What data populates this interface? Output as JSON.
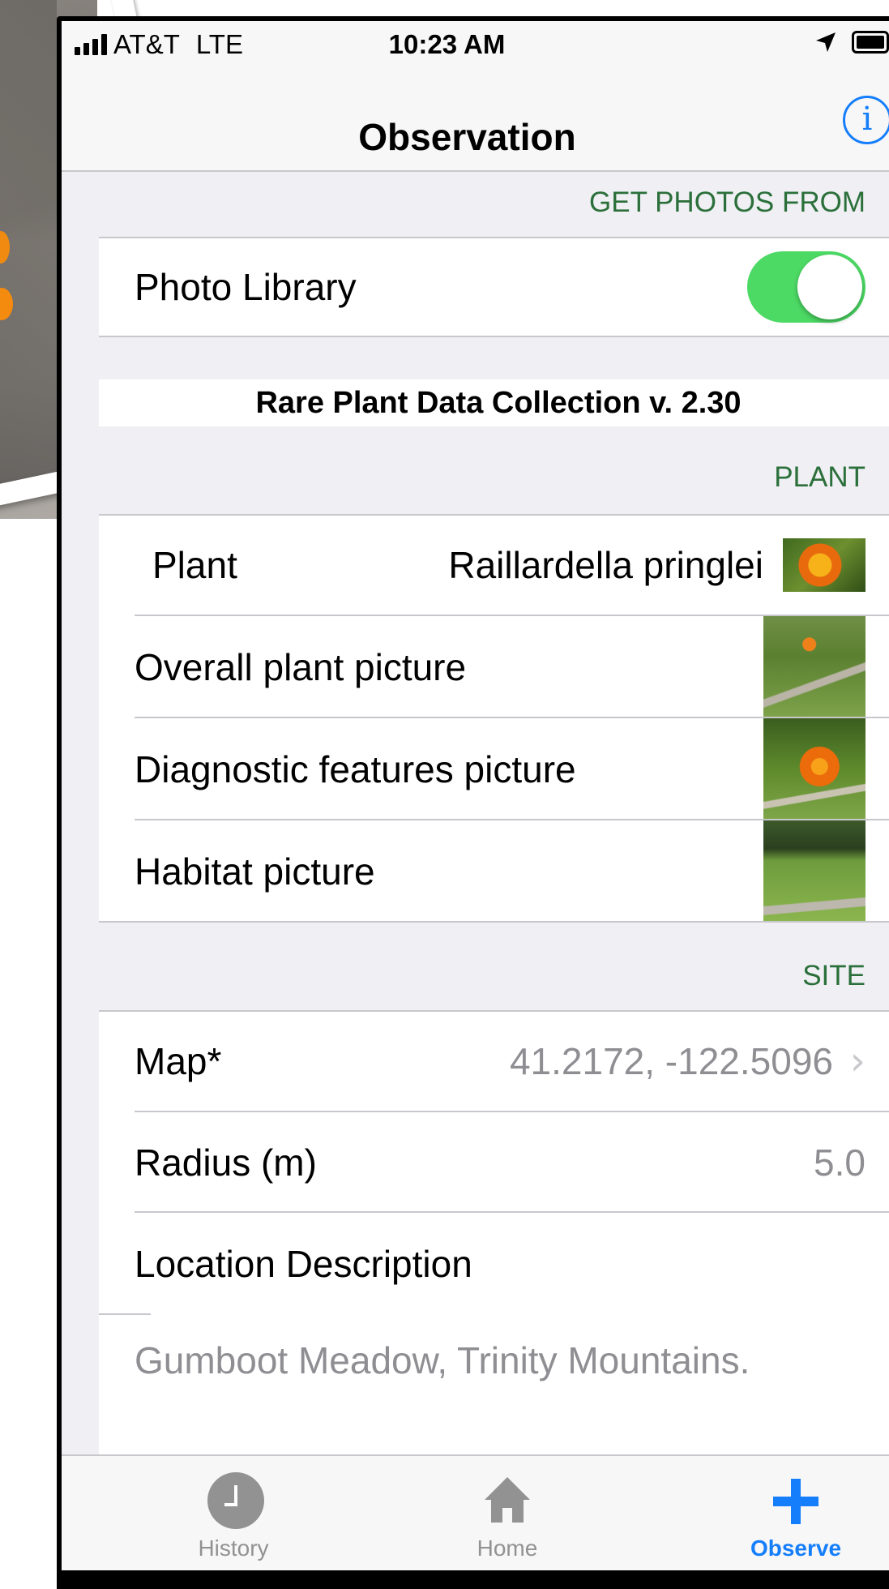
{
  "status_bar": {
    "carrier": "AT&T",
    "network": "LTE",
    "time": "10:23 AM"
  },
  "nav": {
    "title": "Observation",
    "info_icon": "info-icon"
  },
  "sections": {
    "photos_header": "GET PHOTOS FROM",
    "photo_library_label": "Photo Library",
    "photo_library_enabled": true,
    "footer_title": "Rare Plant Data Collection v. 2.30",
    "plant_header": "PLANT",
    "plant_label": "Plant",
    "plant_value": "Raillardella pringlei",
    "overall_label": "Overall plant picture",
    "diagnostic_label": "Diagnostic features picture",
    "habitat_label": "Habitat picture",
    "site_header": "SITE",
    "map_label": "Map*",
    "map_value": "41.2172, -122.5096",
    "radius_label": "Radius (m)",
    "radius_value": "5.0",
    "location_label": "Location Description",
    "location_value": "Gumboot Meadow, Trinity Mountains."
  },
  "tabs": [
    {
      "label": "History",
      "icon": "clock-icon",
      "active": false
    },
    {
      "label": "Home",
      "icon": "home-icon",
      "active": false
    },
    {
      "label": "Observe",
      "icon": "plus-icon",
      "active": true
    }
  ],
  "colors": {
    "accent": "#157efb",
    "toggle_on": "#4cd964",
    "section_header_text": "#2b6f3a"
  }
}
